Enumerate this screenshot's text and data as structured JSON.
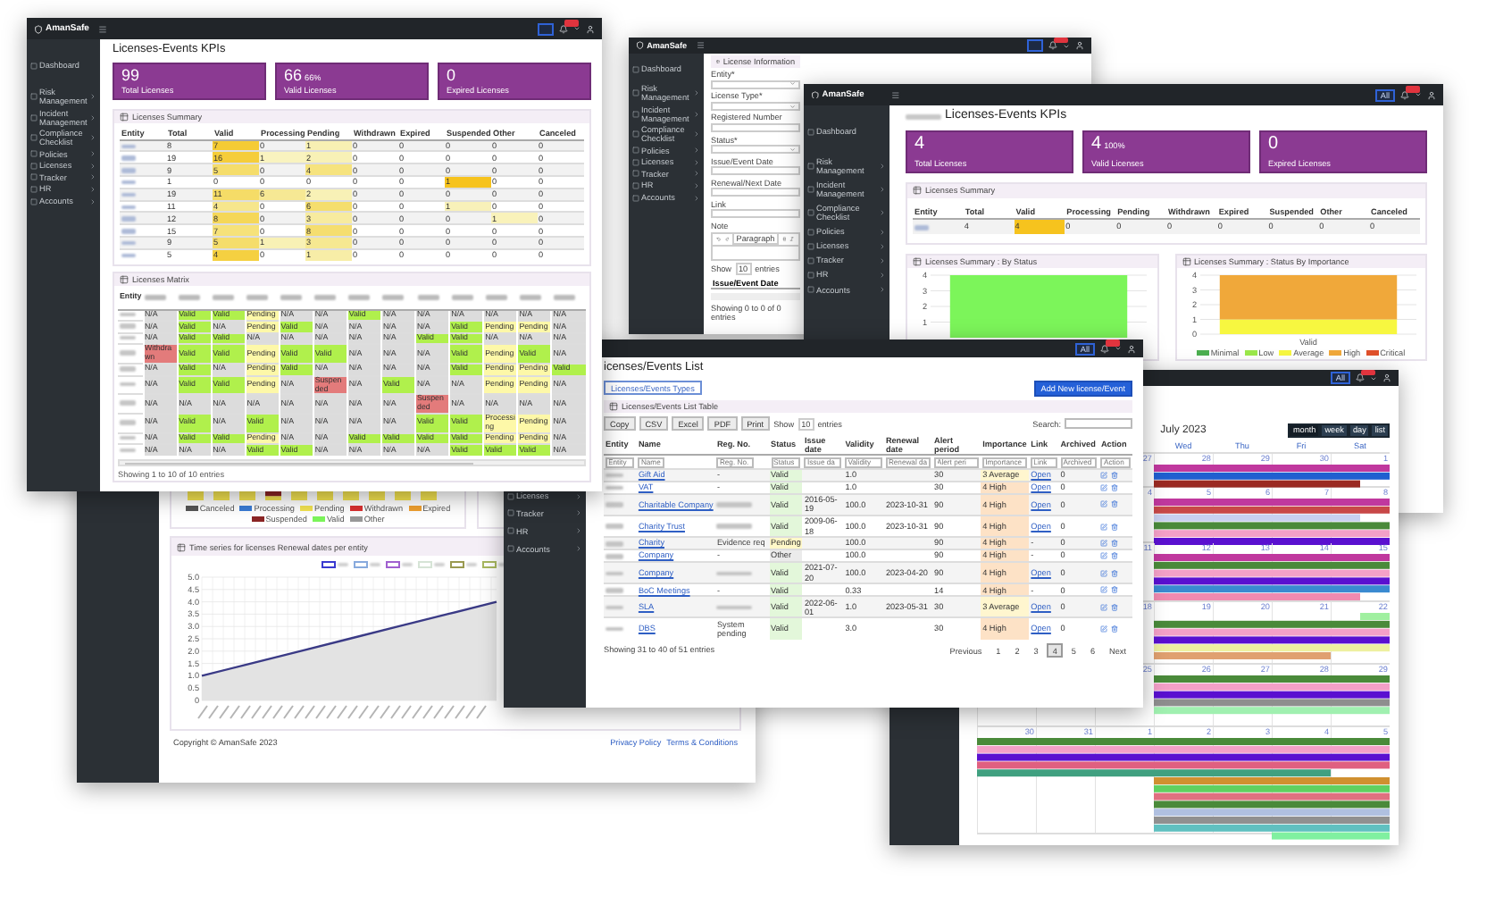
{
  "main_window": {
    "brand": "AmanSafe",
    "nav_groups": [
      [
        {
          "label": "Dashboard",
          "expandable": false
        }
      ],
      [
        {
          "label": "Risk Management",
          "expandable": true
        },
        {
          "label": "Incident Management",
          "expandable": true
        },
        {
          "label": "Compliance Checklist",
          "expandable": true
        },
        {
          "label": "Policies",
          "expandable": true
        },
        {
          "label": "Licenses",
          "expandable": true
        },
        {
          "label": "Tracker",
          "expandable": true
        },
        {
          "label": "HR",
          "expandable": true
        },
        {
          "label": "Accounts",
          "expandable": true
        }
      ]
    ],
    "title": "Licenses-Events KPIs",
    "kpis": [
      {
        "value": "99",
        "label": "Total Licenses"
      },
      {
        "value": "66",
        "percent": "66%",
        "label": "Valid Licenses"
      },
      {
        "value": "0",
        "label": "Expired Licenses"
      }
    ],
    "summary": {
      "title": "Licenses Summary",
      "columns": [
        "Entity",
        "Total",
        "Valid",
        "Processing",
        "Pending",
        "Withdrawn",
        "Expired",
        "Suspended",
        "Other",
        "Canceled"
      ],
      "rows": [
        {
          "values": [
            "8",
            "7",
            "0",
            "1",
            "0",
            "0",
            "0",
            "0",
            "0"
          ]
        },
        {
          "values": [
            "19",
            "16",
            "1",
            "2",
            "0",
            "0",
            "0",
            "0",
            "0"
          ]
        },
        {
          "values": [
            "9",
            "5",
            "0",
            "4",
            "0",
            "0",
            "0",
            "0",
            "0"
          ]
        },
        {
          "values": [
            "1",
            "0",
            "0",
            "0",
            "0",
            "0",
            "1",
            "0",
            "0"
          ]
        },
        {
          "values": [
            "19",
            "11",
            "6",
            "2",
            "0",
            "0",
            "0",
            "0",
            "0"
          ]
        },
        {
          "values": [
            "11",
            "4",
            "0",
            "6",
            "0",
            "0",
            "1",
            "0",
            "0"
          ]
        },
        {
          "values": [
            "12",
            "8",
            "0",
            "3",
            "0",
            "0",
            "0",
            "1",
            "0"
          ]
        },
        {
          "values": [
            "15",
            "7",
            "0",
            "8",
            "0",
            "0",
            "0",
            "0",
            "0"
          ]
        },
        {
          "values": [
            "9",
            "5",
            "1",
            "3",
            "0",
            "0",
            "0",
            "0",
            "0"
          ]
        },
        {
          "values": [
            "5",
            "4",
            "0",
            "1",
            "0",
            "0",
            "0",
            "0",
            "0"
          ]
        }
      ]
    },
    "matrix": {
      "title": "Licenses Matrix",
      "first_column": "Entity",
      "footer": "Showing 1 to 10 of 10 entries",
      "rows": [
        {
          "cells": [
            {
              "kind": "na",
              "text": "N/A"
            },
            {
              "kind": "valid",
              "text": "Valid"
            },
            {
              "kind": "valid",
              "text": "Valid"
            },
            {
              "kind": "pending",
              "text": "Pending"
            },
            {
              "kind": "na",
              "text": "N/A"
            },
            {
              "kind": "na",
              "text": "N/A"
            },
            {
              "kind": "valid",
              "text": "Valid"
            },
            {
              "kind": "na",
              "text": "N/A"
            },
            {
              "kind": "na",
              "text": "N/A"
            },
            {
              "kind": "na",
              "text": "N/A"
            },
            {
              "kind": "na",
              "text": "N/A"
            },
            {
              "kind": "na",
              "text": "N/A"
            },
            {
              "kind": "na",
              "text": "N/A"
            }
          ]
        },
        {
          "cells": [
            {
              "kind": "na",
              "text": "N/A"
            },
            {
              "kind": "valid",
              "text": "Valid"
            },
            {
              "kind": "na",
              "text": "N/A"
            },
            {
              "kind": "pending",
              "text": "Pending"
            },
            {
              "kind": "valid",
              "text": "Valid"
            },
            {
              "kind": "na",
              "text": "N/A"
            },
            {
              "kind": "na",
              "text": "N/A"
            },
            {
              "kind": "na",
              "text": "N/A"
            },
            {
              "kind": "na",
              "text": "N/A"
            },
            {
              "kind": "valid",
              "text": "Valid"
            },
            {
              "kind": "pending",
              "text": "Pending"
            },
            {
              "kind": "pending",
              "text": "Pending"
            },
            {
              "kind": "na",
              "text": "N/A"
            }
          ]
        },
        {
          "cells": [
            {
              "kind": "na",
              "text": "N/A"
            },
            {
              "kind": "valid",
              "text": "Valid"
            },
            {
              "kind": "valid",
              "text": "Valid"
            },
            {
              "kind": "na",
              "text": "N/A"
            },
            {
              "kind": "na",
              "text": "N/A"
            },
            {
              "kind": "na",
              "text": "N/A"
            },
            {
              "kind": "na",
              "text": "N/A"
            },
            {
              "kind": "na",
              "text": "N/A"
            },
            {
              "kind": "valid",
              "text": "Valid"
            },
            {
              "kind": "valid",
              "text": "Valid"
            },
            {
              "kind": "na",
              "text": "N/A"
            },
            {
              "kind": "na",
              "text": "N/A"
            },
            {
              "kind": "na",
              "text": "N/A"
            }
          ]
        },
        {
          "cells": [
            {
              "kind": "withdrawn",
              "text": "Withdrawn"
            },
            {
              "kind": "valid",
              "text": "Valid"
            },
            {
              "kind": "valid",
              "text": "Valid"
            },
            {
              "kind": "pending",
              "text": "Pending"
            },
            {
              "kind": "valid",
              "text": "Valid"
            },
            {
              "kind": "valid",
              "text": "Valid"
            },
            {
              "kind": "na",
              "text": "N/A"
            },
            {
              "kind": "na",
              "text": "N/A"
            },
            {
              "kind": "na",
              "text": "N/A"
            },
            {
              "kind": "valid",
              "text": "Valid"
            },
            {
              "kind": "pending",
              "text": "Pending"
            },
            {
              "kind": "valid",
              "text": "Valid"
            },
            {
              "kind": "na",
              "text": "N/A"
            }
          ]
        },
        {
          "cells": [
            {
              "kind": "na",
              "text": "N/A"
            },
            {
              "kind": "valid",
              "text": "Valid"
            },
            {
              "kind": "na",
              "text": "N/A"
            },
            {
              "kind": "pending",
              "text": "Pending"
            },
            {
              "kind": "valid",
              "text": "Valid"
            },
            {
              "kind": "na",
              "text": "N/A"
            },
            {
              "kind": "na",
              "text": "N/A"
            },
            {
              "kind": "na",
              "text": "N/A"
            },
            {
              "kind": "na",
              "text": "N/A"
            },
            {
              "kind": "valid",
              "text": "Valid"
            },
            {
              "kind": "pending",
              "text": "Pending"
            },
            {
              "kind": "pending",
              "text": "Pending"
            },
            {
              "kind": "valid",
              "text": "Valid"
            }
          ]
        },
        {
          "cells": [
            {
              "kind": "na",
              "text": "N/A"
            },
            {
              "kind": "valid",
              "text": "Valid"
            },
            {
              "kind": "valid",
              "text": "Valid"
            },
            {
              "kind": "pending",
              "text": "Pending"
            },
            {
              "kind": "na",
              "text": "N/A"
            },
            {
              "kind": "suspended",
              "text": "Suspended"
            },
            {
              "kind": "na",
              "text": "N/A"
            },
            {
              "kind": "valid",
              "text": "Valid"
            },
            {
              "kind": "na",
              "text": "N/A"
            },
            {
              "kind": "na",
              "text": "N/A"
            },
            {
              "kind": "pending",
              "text": "Pending"
            },
            {
              "kind": "pending",
              "text": "Pending"
            },
            {
              "kind": "na",
              "text": "N/A"
            }
          ]
        },
        {
          "cells": [
            {
              "kind": "na",
              "text": "N/A"
            },
            {
              "kind": "na",
              "text": "N/A"
            },
            {
              "kind": "na",
              "text": "N/A"
            },
            {
              "kind": "na",
              "text": "N/A"
            },
            {
              "kind": "na",
              "text": "N/A"
            },
            {
              "kind": "na",
              "text": "N/A"
            },
            {
              "kind": "na",
              "text": "N/A"
            },
            {
              "kind": "na",
              "text": "N/A"
            },
            {
              "kind": "suspended",
              "text": "Suspended"
            },
            {
              "kind": "na",
              "text": "N/A"
            },
            {
              "kind": "na",
              "text": "N/A"
            },
            {
              "kind": "na",
              "text": "N/A"
            },
            {
              "kind": "na",
              "text": "N/A"
            }
          ]
        },
        {
          "cells": [
            {
              "kind": "na",
              "text": "N/A"
            },
            {
              "kind": "valid",
              "text": "Valid"
            },
            {
              "kind": "na",
              "text": "N/A"
            },
            {
              "kind": "valid",
              "text": "Valid"
            },
            {
              "kind": "na",
              "text": "N/A"
            },
            {
              "kind": "na",
              "text": "N/A"
            },
            {
              "kind": "na",
              "text": "N/A"
            },
            {
              "kind": "na",
              "text": "N/A"
            },
            {
              "kind": "valid",
              "text": "Valid"
            },
            {
              "kind": "valid",
              "text": "Valid"
            },
            {
              "kind": "processing",
              "text": "Processing"
            },
            {
              "kind": "pending",
              "text": "Pending"
            },
            {
              "kind": "na",
              "text": "N/A"
            }
          ]
        },
        {
          "cells": [
            {
              "kind": "na",
              "text": "N/A"
            },
            {
              "kind": "valid",
              "text": "Valid"
            },
            {
              "kind": "valid",
              "text": "Valid"
            },
            {
              "kind": "pending",
              "text": "Pending"
            },
            {
              "kind": "na",
              "text": "N/A"
            },
            {
              "kind": "na",
              "text": "N/A"
            },
            {
              "kind": "valid",
              "text": "Valid"
            },
            {
              "kind": "valid",
              "text": "Valid"
            },
            {
              "kind": "valid",
              "text": "Valid"
            },
            {
              "kind": "valid",
              "text": "Valid"
            },
            {
              "kind": "pending",
              "text": "Pending"
            },
            {
              "kind": "pending",
              "text": "Pending"
            },
            {
              "kind": "na",
              "text": "N/A"
            }
          ]
        },
        {
          "cells": [
            {
              "kind": "na",
              "text": "N/A"
            },
            {
              "kind": "na",
              "text": "N/A"
            },
            {
              "kind": "na",
              "text": "N/A"
            },
            {
              "kind": "valid",
              "text": "Valid"
            },
            {
              "kind": "valid",
              "text": "Valid"
            },
            {
              "kind": "na",
              "text": "N/A"
            },
            {
              "kind": "na",
              "text": "N/A"
            },
            {
              "kind": "na",
              "text": "N/A"
            },
            {
              "kind": "na",
              "text": "N/A"
            },
            {
              "kind": "valid",
              "text": "Valid"
            },
            {
              "kind": "valid",
              "text": "Valid"
            },
            {
              "kind": "valid",
              "text": "Valid"
            },
            {
              "kind": "na",
              "text": "N/A"
            }
          ]
        }
      ]
    }
  },
  "form_window": {
    "brand": "AmanSafe",
    "nav_groups": [
      [
        {
          "label": "Dashboard",
          "expandable": false
        }
      ],
      [
        {
          "label": "Risk Management",
          "expandable": true
        },
        {
          "label": "Incident Management",
          "expandable": true
        },
        {
          "label": "Compliance Checklist",
          "expandable": true
        },
        {
          "label": "Policies",
          "expandable": true
        },
        {
          "label": "Licenses",
          "expandable": true
        },
        {
          "label": "Tracker",
          "expandable": true
        },
        {
          "label": "HR",
          "expandable": true
        },
        {
          "label": "Accounts",
          "expandable": true
        }
      ]
    ],
    "card_title": "License Information",
    "fields": [
      {
        "label": "Entity*",
        "kind": "select"
      },
      {
        "label": "License Type*",
        "kind": "select"
      },
      {
        "label": "Registered Number",
        "kind": "text"
      },
      {
        "label": "Status*",
        "kind": "select"
      },
      {
        "label": "Issue/Event Date",
        "kind": "text"
      },
      {
        "label": "Renewal/Next Date",
        "kind": "text"
      },
      {
        "label": "Link",
        "kind": "text"
      }
    ],
    "note": {
      "label": "Note",
      "style_select": "Paragraph"
    },
    "table": {
      "show": "Show",
      "page_size": "10",
      "entries": "entries",
      "column": "Issue/Event Date",
      "footer": "Showing 0 to 0 of 0 entries"
    }
  },
  "kpi_window": {
    "brand": "AmanSafe",
    "filter": "All",
    "nav_groups": [
      [
        {
          "label": "Dashboard",
          "expandable": false
        }
      ],
      [
        {
          "label": "Risk Management",
          "expandable": true
        },
        {
          "label": "Incident Management",
          "expandable": true
        },
        {
          "label": "Compliance Checklist",
          "expandable": true
        },
        {
          "label": "Policies",
          "expandable": true
        },
        {
          "label": "Licenses",
          "expandable": true
        },
        {
          "label": "Tracker",
          "expandable": true
        },
        {
          "label": "HR",
          "expandable": true
        },
        {
          "label": "Accounts",
          "expandable": true
        }
      ]
    ],
    "title": "Licenses-Events KPIs",
    "kpis": [
      {
        "value": "4",
        "label": "Total Licenses"
      },
      {
        "value": "4",
        "percent": "100%",
        "label": "Valid Licenses"
      },
      {
        "value": "0",
        "label": "Expired Licenses"
      }
    ],
    "summary": {
      "title": "Licenses Summary",
      "columns": [
        "Entity",
        "Total",
        "Valid",
        "Processing",
        "Pending",
        "Withdrawn",
        "Expired",
        "Suspended",
        "Other",
        "Canceled"
      ],
      "rows": [
        {
          "values": [
            "4",
            "4",
            "0",
            "0",
            "0",
            "0",
            "0",
            "0",
            "0"
          ]
        }
      ]
    },
    "charts": [
      {
        "title": "Licenses Summary : By Status",
        "chart_data": {
          "type": "bar",
          "grid": true,
          "ylim": [
            0,
            4
          ],
          "yticks": [
            1,
            2,
            3,
            4
          ],
          "series": [
            {
              "color": "#7cf55a",
              "values": [
                4
              ]
            }
          ]
        }
      },
      {
        "title": "Licenses Summary : Status By Importance",
        "chart_data": {
          "type": "bar",
          "grid": true,
          "stacked": true,
          "ylim": [
            0,
            4
          ],
          "yticks": [
            0,
            1,
            2,
            3,
            4
          ],
          "categories": [
            "Valid"
          ],
          "series": [
            {
              "name": "Minimal",
              "color": "#4caf50",
              "values": [
                0
              ]
            },
            {
              "name": "Low",
              "color": "#9be84a",
              "values": [
                0
              ]
            },
            {
              "name": "Average",
              "color": "#f7f740",
              "values": [
                1
              ]
            },
            {
              "name": "High",
              "color": "#f0a83a",
              "values": [
                3
              ]
            },
            {
              "name": "Critical",
              "color": "#e0502a",
              "values": [
                0
              ]
            }
          ]
        }
      }
    ]
  },
  "list_window": {
    "filter": "All",
    "nav": [
      {
        "label": "Licenses",
        "expandable": true
      },
      {
        "label": "Tracker",
        "expandable": true
      },
      {
        "label": "HR",
        "expandable": true
      },
      {
        "label": "Accounts",
        "expandable": true
      }
    ],
    "title": "icenses/Events List",
    "types_button": "Licenses/Events Types",
    "add_button": "Add New license/Event",
    "card_title": "Licenses/Events List Table",
    "export_buttons": [
      "Copy",
      "CSV",
      "Excel",
      "PDF",
      "Print"
    ],
    "show": "Show",
    "page_size": "10",
    "entries": "entries",
    "search_label": "Search:",
    "columns": [
      {
        "label": "Entity",
        "placeholder": "Entity"
      },
      {
        "label": "Name",
        "placeholder": "Name"
      },
      {
        "label": "Reg. No.",
        "placeholder": "Reg. No."
      },
      {
        "label": "Status",
        "placeholder": "Status"
      },
      {
        "label": "Issue date",
        "placeholder": "Issue da"
      },
      {
        "label": "Validity",
        "placeholder": "Validity"
      },
      {
        "label": "Renewal date",
        "placeholder": "Renewal da"
      },
      {
        "label": "Alert period",
        "placeholder": "Alert peri"
      },
      {
        "label": "Importance",
        "placeholder": "Importance"
      },
      {
        "label": "Link",
        "placeholder": "Link"
      },
      {
        "label": "Archived",
        "placeholder": "Archived"
      },
      {
        "label": "Action",
        "placeholder": "Action"
      }
    ],
    "rows": [
      {
        "name": "Gift Aid",
        "reg_no": "-",
        "status": {
          "text": "Valid",
          "kind": "valid"
        },
        "validity": "1.0",
        "alert": "30",
        "importance": {
          "text": "3 Average",
          "kind": "average"
        },
        "link": {
          "text": "Open",
          "kind": "link"
        },
        "archived": "0"
      },
      {
        "name": "VAT",
        "reg_no": "-",
        "status": {
          "text": "Valid",
          "kind": "valid"
        },
        "validity": "1.0",
        "alert": "30",
        "importance": {
          "text": "4 High",
          "kind": "high"
        },
        "link": {
          "text": "Open",
          "kind": "link"
        },
        "archived": "0"
      },
      {
        "name": "Charitable Company",
        "status": {
          "text": "Valid",
          "kind": "valid"
        },
        "issue_date": "2016-05-19",
        "validity": "100.0",
        "renewal_date": "2023-10-31",
        "alert": "90",
        "importance": {
          "text": "4 High",
          "kind": "high"
        },
        "link": {
          "text": "Open",
          "kind": "link"
        },
        "archived": "0"
      },
      {
        "name": "Charity Trust",
        "status": {
          "text": "Valid",
          "kind": "valid"
        },
        "issue_date": "2009-06-18",
        "validity": "100.0",
        "renewal_date": "2023-10-31",
        "alert": "90",
        "importance": {
          "text": "4 High",
          "kind": "high"
        },
        "link": {
          "text": "Open",
          "kind": "link"
        },
        "archived": "0"
      },
      {
        "name": "Charity",
        "reg_no": "Evidence req",
        "status": {
          "text": "Pending",
          "kind": "pending"
        },
        "validity": "100.0",
        "alert": "90",
        "importance": {
          "text": "4 High",
          "kind": "high"
        },
        "link": {
          "text": "-",
          "kind": "none"
        },
        "archived": "0"
      },
      {
        "name": "Company",
        "reg_no": "-",
        "status": {
          "text": "Other",
          "kind": "other"
        },
        "validity": "100.0",
        "alert": "90",
        "importance": {
          "text": "4 High",
          "kind": "high"
        },
        "link": {
          "text": "-",
          "kind": "none"
        },
        "archived": "0"
      },
      {
        "name": "Company",
        "status": {
          "text": "Valid",
          "kind": "valid"
        },
        "issue_date": "2021-07-20",
        "validity": "100.0",
        "renewal_date": "2023-04-20",
        "alert": "90",
        "importance": {
          "text": "4 High",
          "kind": "high"
        },
        "link": {
          "text": "Open",
          "kind": "link"
        },
        "archived": "0"
      },
      {
        "name": "BoC Meetings",
        "reg_no": "-",
        "status": {
          "text": "Valid",
          "kind": "valid"
        },
        "validity": "0.33",
        "alert": "14",
        "importance": {
          "text": "4 High",
          "kind": "high"
        },
        "link": {
          "text": "-",
          "kind": "none"
        },
        "archived": "0"
      },
      {
        "name": "SLA",
        "status": {
          "text": "Valid",
          "kind": "valid"
        },
        "issue_date": "2022-06-01",
        "validity": "1.0",
        "renewal_date": "2023-05-31",
        "alert": "30",
        "importance": {
          "text": "3 Average",
          "kind": "average"
        },
        "link": {
          "text": "Open",
          "kind": "link"
        },
        "archived": "0"
      },
      {
        "name": "DBS",
        "reg_no": "System pending",
        "status": {
          "text": "Valid",
          "kind": "valid"
        },
        "validity": "3.0",
        "alert": "30",
        "importance": {
          "text": "4 High",
          "kind": "high"
        },
        "link": {
          "text": "Open",
          "kind": "link"
        },
        "archived": "0"
      }
    ],
    "footer": "Showing 31 to 40 of 51 entries",
    "pagination": [
      {
        "label": "Previous",
        "selected": false
      },
      {
        "label": "1",
        "selected": false
      },
      {
        "label": "2",
        "selected": false
      },
      {
        "label": "3",
        "selected": false
      },
      {
        "label": "4",
        "selected": true
      },
      {
        "label": "5",
        "selected": false
      },
      {
        "label": "6",
        "selected": false
      },
      {
        "label": "Next",
        "selected": false
      }
    ]
  },
  "report_window": {
    "status_legend": [
      {
        "label": "Canceled",
        "color": "#555555"
      },
      {
        "label": "Processing",
        "color": "#3a7bd5"
      },
      {
        "label": "Pending",
        "color": "#f3e350"
      },
      {
        "label": "Withdrawn",
        "color": "#d93030"
      },
      {
        "label": "Expired",
        "color": "#f0a030"
      },
      {
        "label": "Suspended",
        "color": "#8b2525"
      },
      {
        "label": "Valid",
        "color": "#7cf55a"
      },
      {
        "label": "Other",
        "color": "#999999"
      }
    ],
    "timeseries": {
      "title": "Time series for licenses Renewal dates per entity",
      "legend": [
        {
          "color": "#3a3ad0"
        },
        {
          "color": "#88aadd"
        },
        {
          "color": "#a060d0"
        },
        {
          "color": "#d6e4d6"
        },
        {
          "color": "#9a9a50"
        },
        {
          "color": "#a8b860"
        }
      ],
      "chart_data": {
        "type": "area",
        "grid": true,
        "ylim": [
          0,
          5
        ],
        "yticks": [
          {
            "value": 0,
            "label": "0"
          },
          {
            "value": 0.5,
            "label": "0.5"
          },
          {
            "value": 1,
            "label": "1.0"
          },
          {
            "value": 1.5,
            "label": "1.5"
          },
          {
            "value": 2,
            "label": "2.0"
          },
          {
            "value": 2.5,
            "label": "2.5"
          },
          {
            "value": 3,
            "label": "3.0"
          },
          {
            "value": 3.5,
            "label": "3.5"
          },
          {
            "value": 4,
            "label": "4.0"
          },
          {
            "value": 4.5,
            "label": "4.5"
          },
          {
            "value": 5,
            "label": "5.0"
          }
        ],
        "series": [
          {
            "color": "#3a3a86",
            "values": [
              1.0,
              1.5,
              2.0,
              2.5,
              3.0,
              3.5,
              4.0
            ]
          }
        ]
      }
    },
    "copyright": "Copyright © AmanSafe 2023",
    "links": [
      "Privacy Policy",
      "Terms & Conditions"
    ]
  },
  "calendar_window": {
    "filter": "All",
    "title": "July 2023",
    "views": [
      {
        "label": "month",
        "selected": true
      },
      {
        "label": "week",
        "selected": false
      },
      {
        "label": "day",
        "selected": false
      },
      {
        "label": "list",
        "selected": false
      }
    ],
    "weekdays": [
      "Wed",
      "Thu",
      "Fri",
      "Sat"
    ],
    "weeks": [
      {
        "days": [
          "27",
          "28",
          "29",
          "30",
          "1"
        ]
      },
      {
        "days": [
          "4",
          "5",
          "6",
          "7",
          "8"
        ]
      },
      {
        "days": [
          "11",
          "12",
          "13",
          "14",
          "15"
        ]
      },
      {
        "days": [
          "18",
          "19",
          "20",
          "21",
          "22"
        ]
      },
      {
        "days": [
          "25",
          "26",
          "27",
          "28",
          "29"
        ]
      },
      {
        "days": [
          "30",
          "31",
          "1",
          "2",
          "3",
          "4",
          "5"
        ]
      }
    ]
  }
}
